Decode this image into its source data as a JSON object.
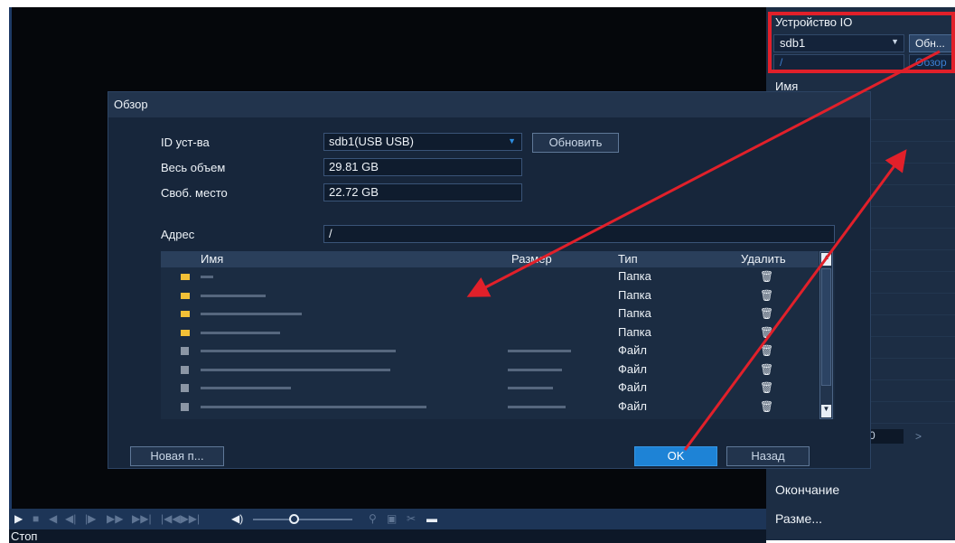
{
  "side_panel": {
    "title": "Устройство IO",
    "device_value": "sdb1",
    "refresh_label": "Обн...",
    "path_value": "/",
    "browse_label": "Обзор",
    "name_header": "Имя",
    "page_value": "0",
    "end_label": "Окончание",
    "size_label": "Разме..."
  },
  "dialog": {
    "title": "Обзор",
    "device_id_label": "ID уст-ва",
    "device_id_value": "sdb1(USB USB)",
    "refresh_button": "Обновить",
    "total_label": "Весь объем",
    "total_value": "29.81 GB",
    "free_label": "Своб. место",
    "free_value": "22.72 GB",
    "address_label": "Адрес",
    "address_value": "/",
    "table": {
      "headers": {
        "name": "Имя",
        "size": "Размер",
        "type": "Тип",
        "delete": "Удалить"
      },
      "rows": [
        {
          "kind": "folder",
          "type": "Папка"
        },
        {
          "kind": "folder",
          "type": "Папка"
        },
        {
          "kind": "folder",
          "type": "Папка"
        },
        {
          "kind": "folder",
          "type": "Папка"
        },
        {
          "kind": "file",
          "type": "Файл"
        },
        {
          "kind": "file",
          "type": "Файл"
        },
        {
          "kind": "file",
          "type": "Файл"
        },
        {
          "kind": "file",
          "type": "Файл"
        }
      ],
      "delete_icon": "trash-icon"
    },
    "new_folder_button": "Новая п...",
    "ok_button": "OK",
    "back_button": "Назад"
  },
  "status": {
    "text": "Стоп"
  },
  "colors": {
    "accent": "#1e83d6",
    "annotation": "#e1202a",
    "folder": "#f2c037",
    "panel": "#1c2d44"
  }
}
